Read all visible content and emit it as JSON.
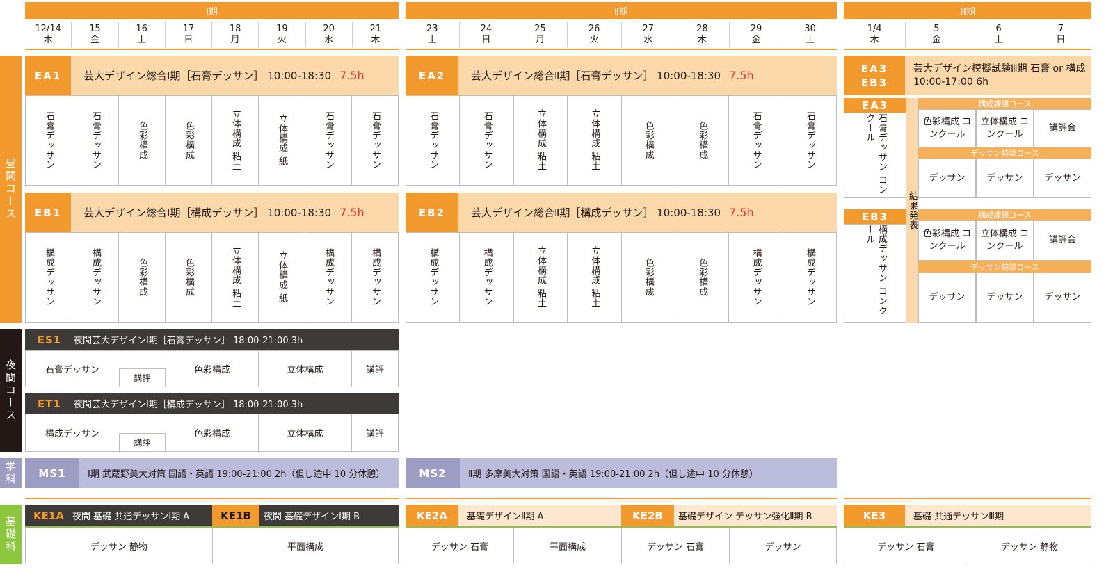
{
  "periods": {
    "p1": "Ⅰ期",
    "p2": "Ⅱ期",
    "p3": "Ⅲ期"
  },
  "dates": {
    "p1": [
      {
        "d": "12/14",
        "w": "木"
      },
      {
        "d": "15",
        "w": "金"
      },
      {
        "d": "16",
        "w": "土"
      },
      {
        "d": "17",
        "w": "日"
      },
      {
        "d": "18",
        "w": "月"
      },
      {
        "d": "19",
        "w": "火"
      },
      {
        "d": "20",
        "w": "水"
      },
      {
        "d": "21",
        "w": "木"
      }
    ],
    "p2": [
      {
        "d": "23",
        "w": "土"
      },
      {
        "d": "24",
        "w": "日"
      },
      {
        "d": "25",
        "w": "月"
      },
      {
        "d": "26",
        "w": "火"
      },
      {
        "d": "27",
        "w": "水"
      },
      {
        "d": "28",
        "w": "木"
      },
      {
        "d": "29",
        "w": "金"
      },
      {
        "d": "30",
        "w": "土"
      }
    ],
    "p3": [
      {
        "d": "1/4",
        "w": "木"
      },
      {
        "d": "5",
        "w": "金"
      },
      {
        "d": "6",
        "w": "土"
      },
      {
        "d": "7",
        "w": "日"
      }
    ]
  },
  "sections": {
    "day": "昼間コース",
    "night": "夜間コース",
    "gakka": "学科",
    "kiso": "基礎科"
  },
  "ea1": {
    "code": "EA1",
    "title": "芸大デザイン総合Ⅰ期［石膏デッサン］ 10:00-18:30",
    "hours": "7.5h",
    "cells": [
      "石膏デッサン",
      "石膏デッサン",
      "色彩構成",
      "色彩構成",
      "立体構成 粘土",
      "立体構成 紙",
      "石膏デッサン",
      "石膏デッサン"
    ]
  },
  "ea2": {
    "code": "EA2",
    "title": "芸大デザイン総合Ⅱ期［石膏デッサン］ 10:00-18:30",
    "hours": "7.5h",
    "cells": [
      "石膏デッサン",
      "石膏デッサン",
      "立体構成 粘土",
      "立体構成 粘土",
      "色彩構成",
      "色彩構成",
      "石膏デッサン",
      "石膏デッサン"
    ]
  },
  "eb1": {
    "code": "EB1",
    "title": "芸大デザイン総合Ⅰ期［構成デッサン］ 10:00-18:30",
    "hours": "7.5h",
    "cells": [
      "構成デッサン",
      "構成デッサン",
      "色彩構成",
      "色彩構成",
      "立体構成 粘土",
      "立体構成 紙",
      "構成デッサン",
      "構成デッサン"
    ]
  },
  "eb2": {
    "code": "EB2",
    "title": "芸大デザイン総合Ⅱ期［構成デッサン］ 10:00-18:30",
    "hours": "7.5h",
    "cells": [
      "構成デッサン",
      "構成デッサン",
      "立体構成 粘土",
      "立体構成 粘土",
      "色彩構成",
      "色彩構成",
      "構成デッサン",
      "構成デッサン"
    ]
  },
  "p3": {
    "code_top": "EA3",
    "code_bottom": "EB3",
    "title_line1": "芸大デザイン模擬試験Ⅲ期 石膏 or 構成",
    "title_line2": "10:00-17:00 6h",
    "ea3_code": "EA3",
    "ea3_cell": "石膏デッサン コンクール",
    "eb3_code": "EB3",
    "eb3_cell": "構成デッサン コンクール",
    "result": "結果発表",
    "sub1": "構成課題コース",
    "sub2": "デッサン特訓コース",
    "row1": [
      "色彩構成 コンクール",
      "立体構成 コンクール",
      "講評会"
    ],
    "row2": [
      "デッサン",
      "デッサン",
      "デッサン"
    ]
  },
  "es1": {
    "code": "ES1",
    "title": "夜間芸大デザインⅠ期［石膏デッサン］ 18:00-21:00 3h",
    "cells": [
      "石膏デッサン",
      "講評",
      "色彩構成",
      "立体構成",
      "講評"
    ]
  },
  "et1": {
    "code": "ET1",
    "title": "夜間芸大デザインⅠ期［構成デッサン］ 18:00-21:00 3h",
    "cells": [
      "構成デッサン",
      "講評",
      "色彩構成",
      "立体構成",
      "講評"
    ]
  },
  "ms1": {
    "code": "MS1",
    "title": "Ⅰ期 武蔵野美大対策 国語・英語 19:00-21:00 2h（但し途中 10 分休憩）"
  },
  "ms2": {
    "code": "MS2",
    "title": "Ⅱ期 多摩美大対策 国語・英語 19:00-21:00 2h（但し途中 10 分休憩）"
  },
  "ke1a": {
    "code": "KE1A",
    "title": "夜間 基礎 共通デッサンⅠ期 A",
    "cell": "デッサン 静物"
  },
  "ke1b": {
    "code": "KE1B",
    "title": "夜間 基礎デザインⅠ期 B",
    "cell": "平面構成"
  },
  "ke2a": {
    "code": "KE2A",
    "title": "基礎デザインⅡ期 A",
    "cells": [
      "デッサン 石膏",
      "平面構成"
    ]
  },
  "ke2b": {
    "code": "KE2B",
    "title": "基礎デザイン デッサン強化Ⅱ期 B",
    "cells": [
      "デッサン 石膏",
      "デッサン"
    ]
  },
  "ke3": {
    "code": "KE3",
    "title": "基礎 共通デッサンⅢ期",
    "cells": [
      "デッサン 石膏",
      "デッサン 静物"
    ]
  },
  "colors": {
    "orange": "#f29a2e",
    "peach": "#fbd8a9",
    "dark": "#3e3a39",
    "lavender": "#bcbddc",
    "green": "#8cc63f",
    "red": "#e7353c"
  }
}
